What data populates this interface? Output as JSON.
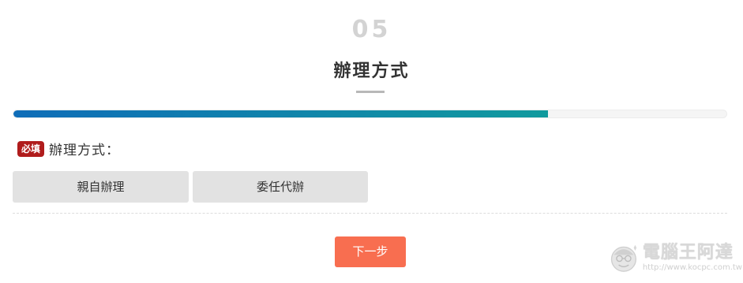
{
  "step": {
    "number": "05",
    "title": "辦理方式"
  },
  "progress": {
    "value_percent": 75,
    "fill_color_start": "#0f6db8",
    "fill_color_end": "#109a9e"
  },
  "field": {
    "required_badge": "必填",
    "label": "辦理方式："
  },
  "options": [
    {
      "label": "親自辦理"
    },
    {
      "label": "委任代辦"
    }
  ],
  "next_button": {
    "label": "下一步",
    "color": "#f86e50"
  },
  "watermark": {
    "title": "電腦王阿達",
    "url": "http://www.kocpc.com.tw"
  }
}
